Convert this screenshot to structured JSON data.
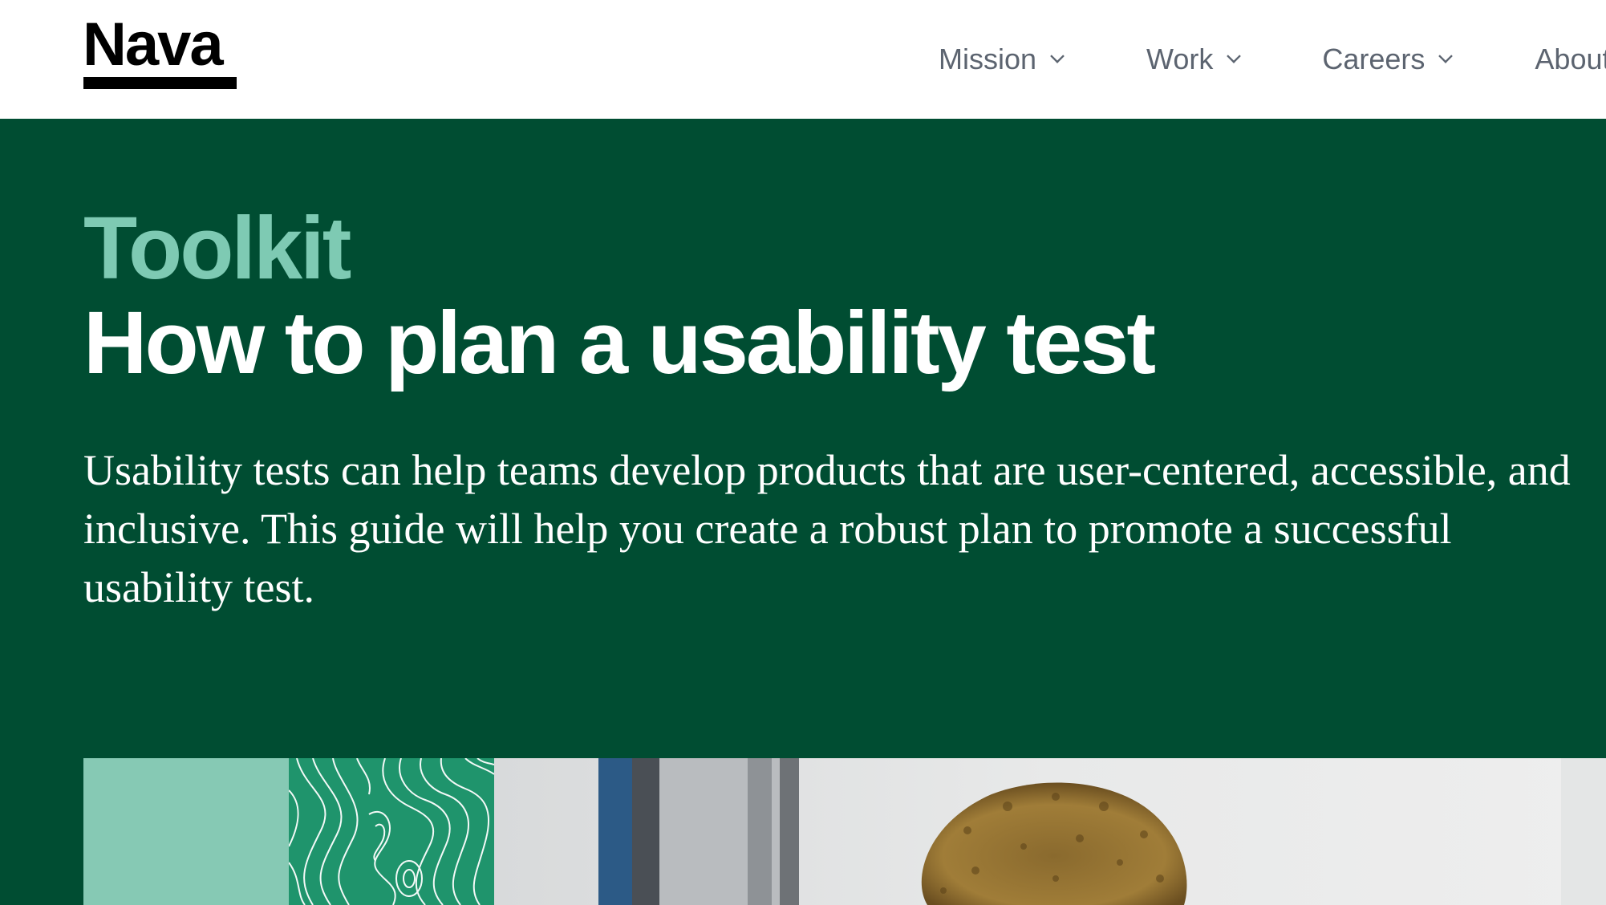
{
  "header": {
    "logo_text": "Nava",
    "nav": [
      {
        "label": "Mission",
        "icon": "chevron-down-icon"
      },
      {
        "label": "Work",
        "icon": "chevron-down-icon"
      },
      {
        "label": "Careers",
        "icon": "chevron-down-icon"
      },
      {
        "label": "About"
      }
    ]
  },
  "hero": {
    "eyebrow": "Toolkit",
    "title": "How to plan a usability test",
    "description": "Usability tests can help teams develop products that are user-centered, accessible, and inclusive. This guide will help you create a robust plan to promote a successful usability test."
  },
  "colors": {
    "hero_background": "#004d32",
    "eyebrow": "#7ecab3",
    "mint_tile": "#86c9b4",
    "pattern_tile": "#1f946c",
    "nav_text": "#5c6470"
  },
  "media": {
    "tiles": [
      "solid-mint-tile",
      "topographic-pattern-tile",
      "person-photo"
    ]
  }
}
